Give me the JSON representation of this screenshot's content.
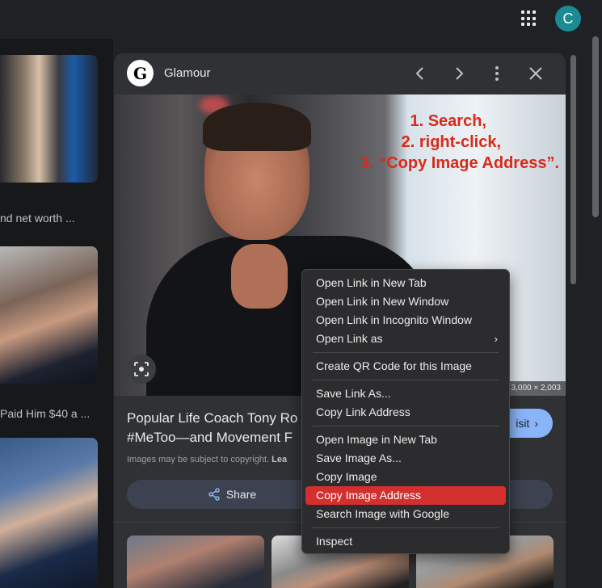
{
  "topbar": {
    "avatar_letter": "C"
  },
  "left_column": {
    "captions": [
      "nd net worth ...",
      "Paid Him $40 a ..."
    ]
  },
  "panel": {
    "site_name": "Glamour",
    "site_logo_letter": "G",
    "image": {
      "overlay_lines": [
        "1. Search,",
        "2. right-click,",
        "3. “Copy Image Address”."
      ],
      "dimensions": "3,000 × 2,003"
    },
    "title_line1": "Popular Life Coach Tony Ro",
    "title_line2": "#MeToo—and Movement F",
    "visit_label": "isit",
    "copyright_text": "Images may be subject to copyright.",
    "copyright_link": "Lea",
    "share_label": "Share"
  },
  "context_menu": {
    "groups": [
      [
        "Open Link in New Tab",
        "Open Link in New Window",
        "Open Link in Incognito Window",
        "Open Link as"
      ],
      [
        "Create QR Code for this Image"
      ],
      [
        "Save Link As...",
        "Copy Link Address"
      ],
      [
        "Open Image in New Tab",
        "Save Image As...",
        "Copy Image",
        "Copy Image Address",
        "Search Image with Google"
      ],
      [
        "Inspect"
      ]
    ],
    "highlighted": "Copy Image Address"
  },
  "colors": {
    "background": "#202124",
    "panel": "#303134",
    "menu_highlight": "#d32f2f",
    "visit_button": "#8ab4f8",
    "avatar": "#1a8a93",
    "overlay_text": "#d82a1a"
  }
}
